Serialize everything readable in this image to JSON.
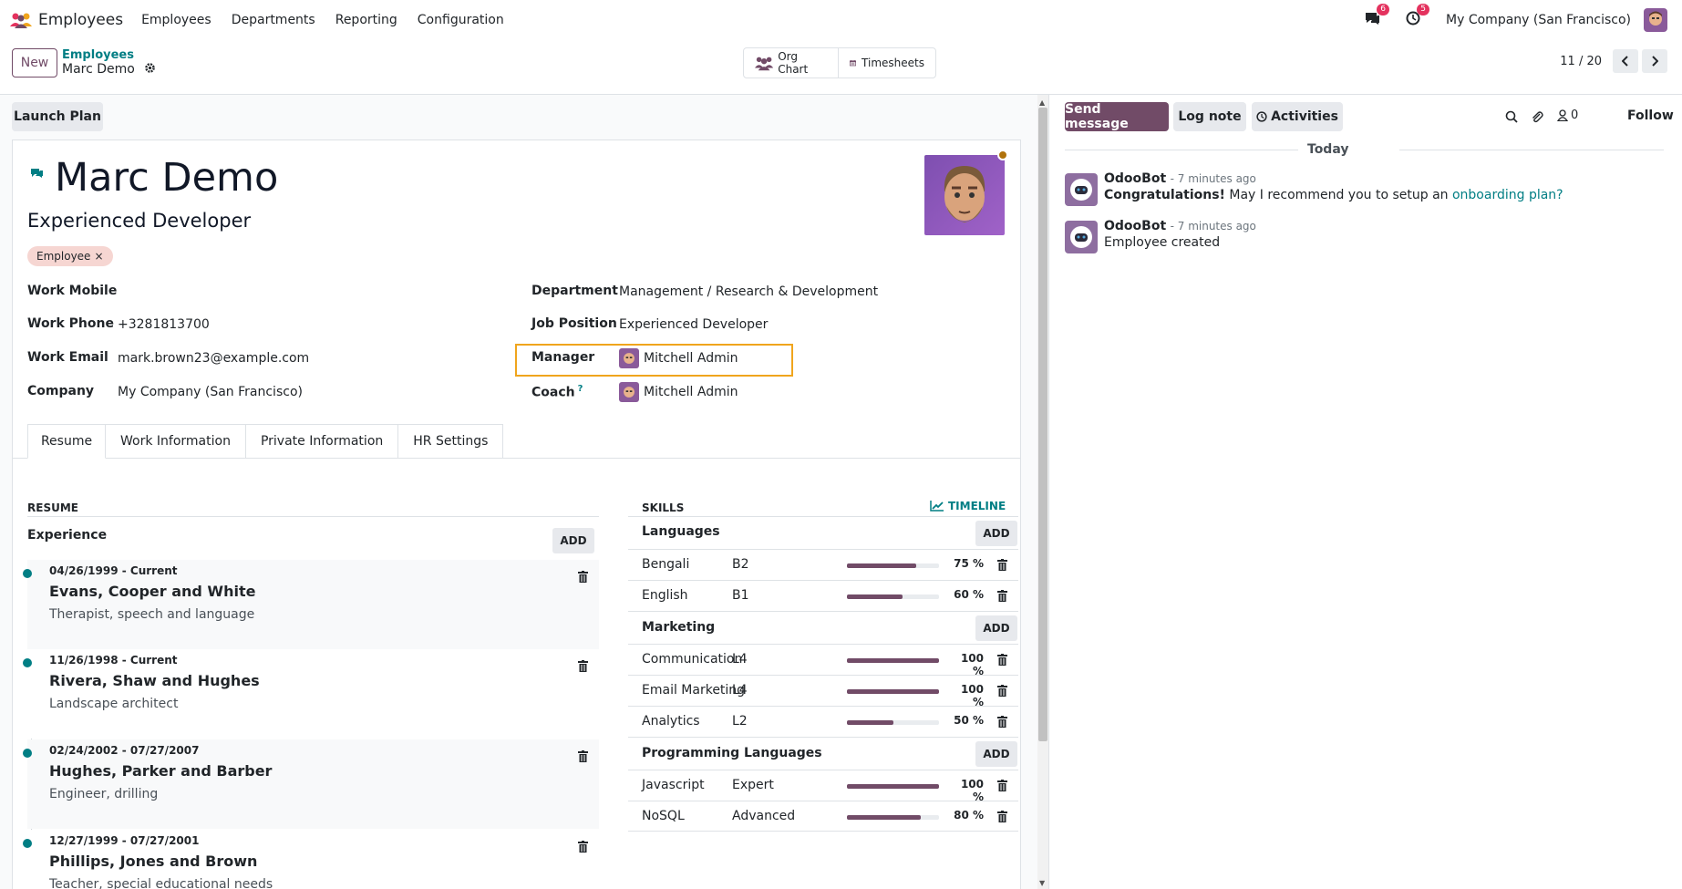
{
  "navbar": {
    "app_title": "Employees",
    "menu": [
      "Employees",
      "Departments",
      "Reporting",
      "Configuration"
    ],
    "messages_badge": "6",
    "activities_badge": "5",
    "company": "My Company (San Francisco)"
  },
  "control": {
    "new_label": "New",
    "breadcrumb_parent": "Employees",
    "breadcrumb_current": "Marc Demo",
    "org_chart_label": "Org Chart",
    "timesheets_label": "Timesheets",
    "pager": "11 / 20"
  },
  "form": {
    "launch_plan_label": "Launch Plan",
    "name": "Marc Demo",
    "job_title": "Experienced Developer",
    "tag": "Employee",
    "fields": {
      "work_mobile_label": "Work Mobile",
      "work_mobile_value": "",
      "work_phone_label": "Work Phone",
      "work_phone_value": "+3281813700",
      "work_email_label": "Work Email",
      "work_email_value": "mark.brown23@example.com",
      "company_label": "Company",
      "company_value": "My Company (San Francisco)",
      "department_label": "Department",
      "department_value": "Management / Research & Development",
      "job_position_label": "Job Position",
      "job_position_value": "Experienced Developer",
      "manager_label": "Manager",
      "manager_value": "Mitchell Admin",
      "coach_label": "Coach",
      "coach_help": "?",
      "coach_value": "Mitchell Admin"
    },
    "tabs": [
      "Resume",
      "Work Information",
      "Private Information",
      "HR Settings"
    ],
    "resume": {
      "heading": "RESUME",
      "experience_label": "Experience",
      "add_label": "ADD",
      "items": [
        {
          "date": "04/26/1999 - Current",
          "company": "Evans, Cooper and White",
          "role": "Therapist, speech and language"
        },
        {
          "date": "11/26/1998 - Current",
          "company": "Rivera, Shaw and Hughes",
          "role": "Landscape architect"
        },
        {
          "date": "02/24/2002 - 07/27/2007",
          "company": "Hughes, Parker and Barber",
          "role": "Engineer, drilling"
        },
        {
          "date": "12/27/1999 - 07/27/2001",
          "company": "Phillips, Jones and Brown",
          "role": "Teacher, special educational needs"
        }
      ]
    },
    "skills": {
      "heading": "SKILLS",
      "timeline_label": "TIMELINE",
      "add_label": "ADD",
      "categories": [
        {
          "name": "Languages",
          "skills": [
            {
              "name": "Bengali",
              "level": "B2",
              "progress": 75,
              "pct": "75 %"
            },
            {
              "name": "English",
              "level": "B1",
              "progress": 60,
              "pct": "60 %"
            }
          ]
        },
        {
          "name": "Marketing",
          "skills": [
            {
              "name": "Communication",
              "level": "L4",
              "progress": 100,
              "pct": "100 %"
            },
            {
              "name": "Email Marketing",
              "level": "L4",
              "progress": 100,
              "pct": "100 %"
            },
            {
              "name": "Analytics",
              "level": "L2",
              "progress": 50,
              "pct": "50 %"
            }
          ]
        },
        {
          "name": "Programming Languages",
          "skills": [
            {
              "name": "Javascript",
              "level": "Expert",
              "progress": 100,
              "pct": "100 %"
            },
            {
              "name": "NoSQL",
              "level": "Advanced",
              "progress": 80,
              "pct": "80 %"
            }
          ]
        }
      ]
    }
  },
  "chatter": {
    "send_message": "Send message",
    "log_note": "Log note",
    "activities": "Activities",
    "followers_count": "0",
    "follow": "Follow",
    "date_separator": "Today",
    "messages": [
      {
        "author": "OdooBot",
        "time": "- 7 minutes ago",
        "bold": "Congratulations!",
        "text": " May I recommend you to setup an ",
        "link": "onboarding plan?"
      },
      {
        "author": "OdooBot",
        "time": "- 7 minutes ago",
        "text": "Employee created"
      }
    ]
  },
  "colors": {
    "brand": "#714b67",
    "teal": "#017e84",
    "highlight": "#f0a51d"
  }
}
